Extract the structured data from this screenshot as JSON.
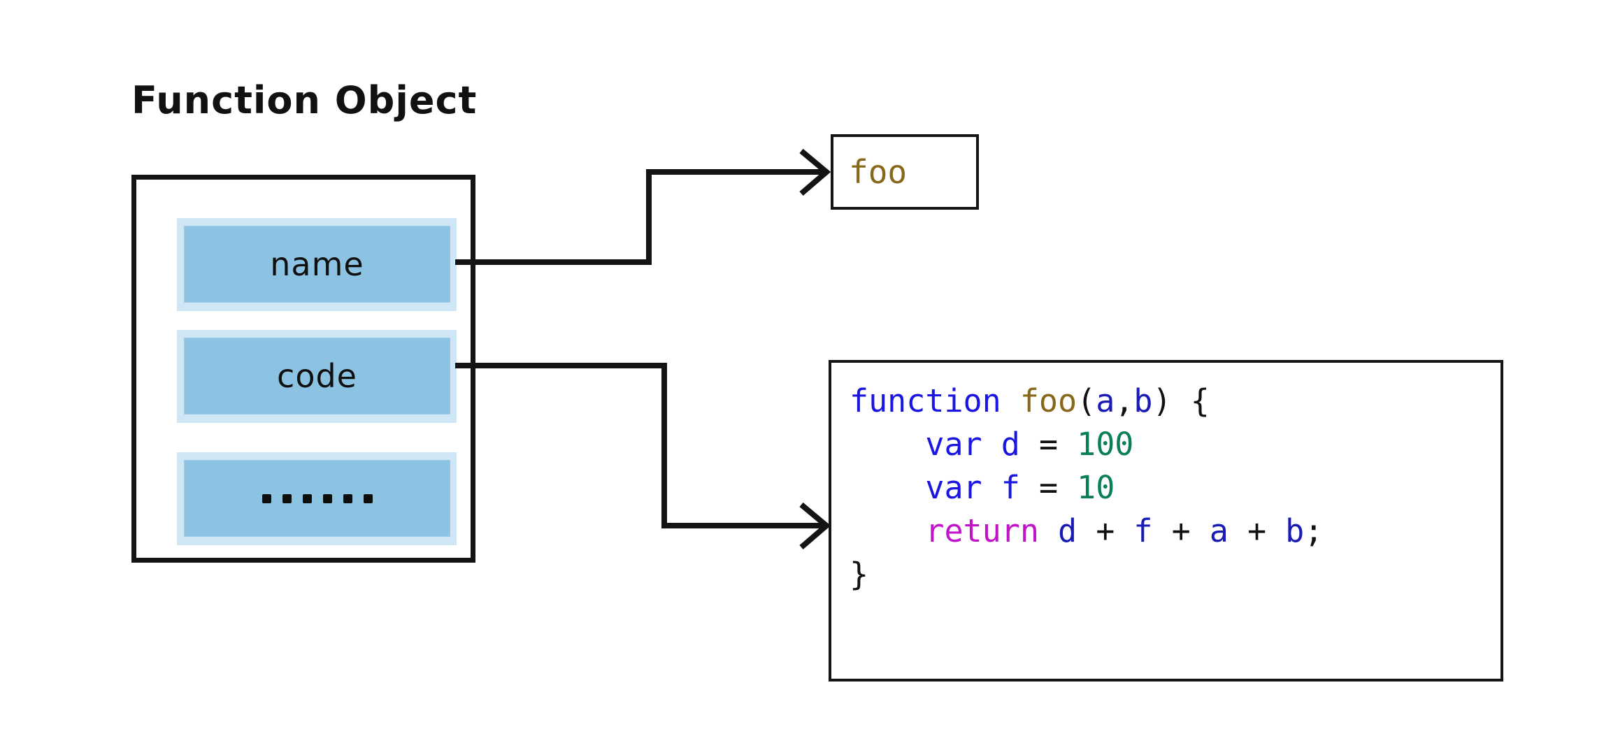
{
  "diagram": {
    "title": "Function Object",
    "background_color": "#ffffff"
  },
  "function_object": {
    "label": "Function Object",
    "slots": [
      {
        "key": "name",
        "label": "name"
      },
      {
        "key": "code",
        "label": "code"
      },
      {
        "key": "more",
        "label": "......",
        "dot_count": 6
      }
    ],
    "box_border_color": "#141414",
    "slot_fill_color": "#8cc3e3",
    "slot_halo_color": "#cfe6f4"
  },
  "name_value": {
    "text": "foo",
    "color": "#87681a"
  },
  "code_value": {
    "lines": [
      {
        "id": "line-1",
        "tokens": [
          {
            "text": "function",
            "type": "keyword",
            "color": "#1a16e0"
          },
          {
            "text": " ",
            "type": "space"
          },
          {
            "text": "foo",
            "type": "function-name",
            "color": "#87681a"
          },
          {
            "text": "(",
            "type": "punctuation",
            "color": "#111111"
          },
          {
            "text": "a",
            "type": "identifier",
            "color": "#1a1ab4"
          },
          {
            "text": ",",
            "type": "punctuation",
            "color": "#111111"
          },
          {
            "text": "b",
            "type": "identifier",
            "color": "#1a1ab4"
          },
          {
            "text": ")",
            "type": "punctuation",
            "color": "#111111"
          },
          {
            "text": " ",
            "type": "space"
          },
          {
            "text": "{",
            "type": "punctuation",
            "color": "#111111"
          }
        ],
        "plain": "function foo(a,b) {"
      },
      {
        "id": "line-2",
        "tokens": [
          {
            "text": "    ",
            "type": "indent"
          },
          {
            "text": "var",
            "type": "keyword",
            "color": "#1a16e0"
          },
          {
            "text": " ",
            "type": "space"
          },
          {
            "text": "d",
            "type": "identifier",
            "color": "#1a16e0"
          },
          {
            "text": " ",
            "type": "space"
          },
          {
            "text": "=",
            "type": "operator",
            "color": "#111111"
          },
          {
            "text": " ",
            "type": "space"
          },
          {
            "text": "100",
            "type": "number",
            "color": "#0a7f55"
          }
        ],
        "plain": "    var d = 100"
      },
      {
        "id": "line-3",
        "tokens": [
          {
            "text": "    ",
            "type": "indent"
          },
          {
            "text": "var",
            "type": "keyword",
            "color": "#1a16e0"
          },
          {
            "text": " ",
            "type": "space"
          },
          {
            "text": "f",
            "type": "identifier",
            "color": "#1a16e0"
          },
          {
            "text": " ",
            "type": "space"
          },
          {
            "text": "=",
            "type": "operator",
            "color": "#111111"
          },
          {
            "text": " ",
            "type": "space"
          },
          {
            "text": "10",
            "type": "number",
            "color": "#0a7f55"
          }
        ],
        "plain": "    var f = 10"
      },
      {
        "id": "line-4",
        "tokens": [
          {
            "text": "    ",
            "type": "indent"
          },
          {
            "text": "return",
            "type": "keyword-return",
            "color": "#c113c9"
          },
          {
            "text": " ",
            "type": "space"
          },
          {
            "text": "d",
            "type": "identifier",
            "color": "#1a1ab4"
          },
          {
            "text": " ",
            "type": "space"
          },
          {
            "text": "+",
            "type": "operator",
            "color": "#111111"
          },
          {
            "text": " ",
            "type": "space"
          },
          {
            "text": "f",
            "type": "identifier",
            "color": "#1a1ab4"
          },
          {
            "text": " ",
            "type": "space"
          },
          {
            "text": "+",
            "type": "operator",
            "color": "#111111"
          },
          {
            "text": " ",
            "type": "space"
          },
          {
            "text": "a",
            "type": "identifier",
            "color": "#1a1ab4"
          },
          {
            "text": " ",
            "type": "space"
          },
          {
            "text": "+",
            "type": "operator",
            "color": "#111111"
          },
          {
            "text": " ",
            "type": "space"
          },
          {
            "text": "b",
            "type": "identifier",
            "color": "#1a1ab4"
          },
          {
            "text": ";",
            "type": "punctuation",
            "color": "#111111"
          }
        ],
        "plain": "    return d + f + a + b;"
      },
      {
        "id": "line-5",
        "tokens": [
          {
            "text": "}",
            "type": "punctuation",
            "color": "#111111"
          }
        ],
        "plain": "}"
      }
    ],
    "source": "function foo(a,b) {\n    var d = 100\n    var f = 10\n    return d + f + a + b;\n}"
  },
  "connectors": [
    {
      "id": "name-to-foo",
      "from": "slot-name",
      "to": "foo-box",
      "style": "orthogonal-step",
      "arrowhead": "open-chevron",
      "color": "#141414"
    },
    {
      "id": "code-to-codebox",
      "from": "slot-code",
      "to": "code-box",
      "style": "orthogonal-step",
      "arrowhead": "open-chevron",
      "color": "#141414"
    }
  ]
}
